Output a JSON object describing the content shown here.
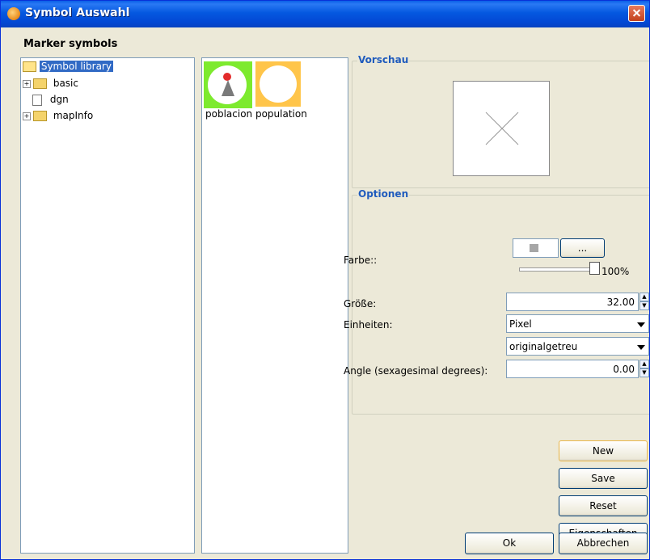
{
  "window": {
    "title": "Symbol Auswahl"
  },
  "section_title": "Marker symbols",
  "tree": {
    "root_label": "Symbol library",
    "items": [
      {
        "label": "basic"
      },
      {
        "label": "dgn"
      },
      {
        "label": "mapInfo"
      }
    ]
  },
  "symbols": [
    {
      "label": "poblacion population"
    }
  ],
  "preview": {
    "title": "Vorschau"
  },
  "options": {
    "title": "Optionen",
    "color_label": "Farbe::",
    "color_button": "...",
    "opacity_text": "100%",
    "opacity_percent": 100,
    "size_label": "Größe:",
    "size_value": "32.00",
    "units_label": "Einheiten:",
    "units_value": "Pixel",
    "units_mode_value": "originalgetreu",
    "angle_label": "Angle (sexagesimal degrees):",
    "angle_value": "0.00"
  },
  "buttons": {
    "new": "New",
    "save": "Save",
    "reset": "Reset",
    "properties": "Eigenschaften",
    "ok": "Ok",
    "cancel": "Abbrechen"
  }
}
